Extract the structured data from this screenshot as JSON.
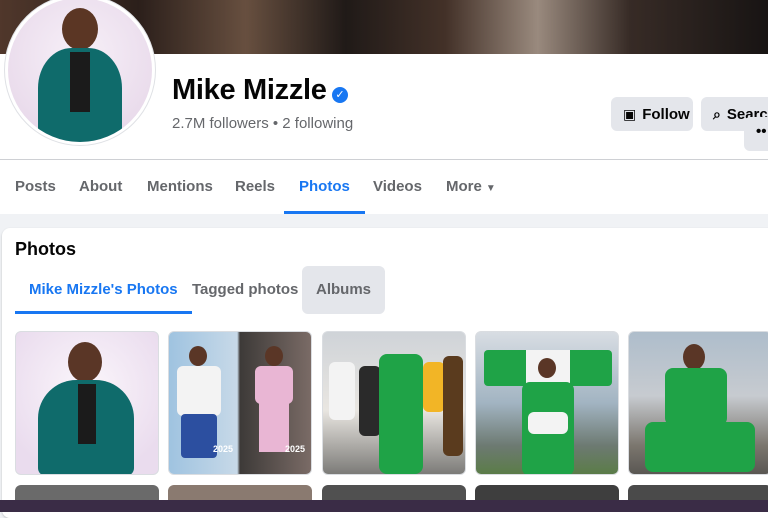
{
  "profile": {
    "name": "Mike Mizzle",
    "verified_icon": "verified-badge-icon",
    "stats": "2.7M followers • 2 following"
  },
  "actions": {
    "follow_label": "Follow",
    "search_label": "Searc",
    "more_label": "••"
  },
  "tabs": [
    {
      "label": "Posts"
    },
    {
      "label": "About"
    },
    {
      "label": "Mentions"
    },
    {
      "label": "Reels"
    },
    {
      "label": "Photos"
    },
    {
      "label": "Videos"
    },
    {
      "label": "More"
    }
  ],
  "photos_section": {
    "title": "Photos",
    "subtabs": [
      {
        "label": "Mike Mizzle's Photos"
      },
      {
        "label": "Tagged photos"
      },
      {
        "label": "Albums"
      }
    ],
    "thumb_labels": [
      "2025",
      "2025"
    ]
  },
  "colors": {
    "accent": "#1877f2",
    "button_bg": "#e4e6eb",
    "muted_text": "#65676b"
  }
}
